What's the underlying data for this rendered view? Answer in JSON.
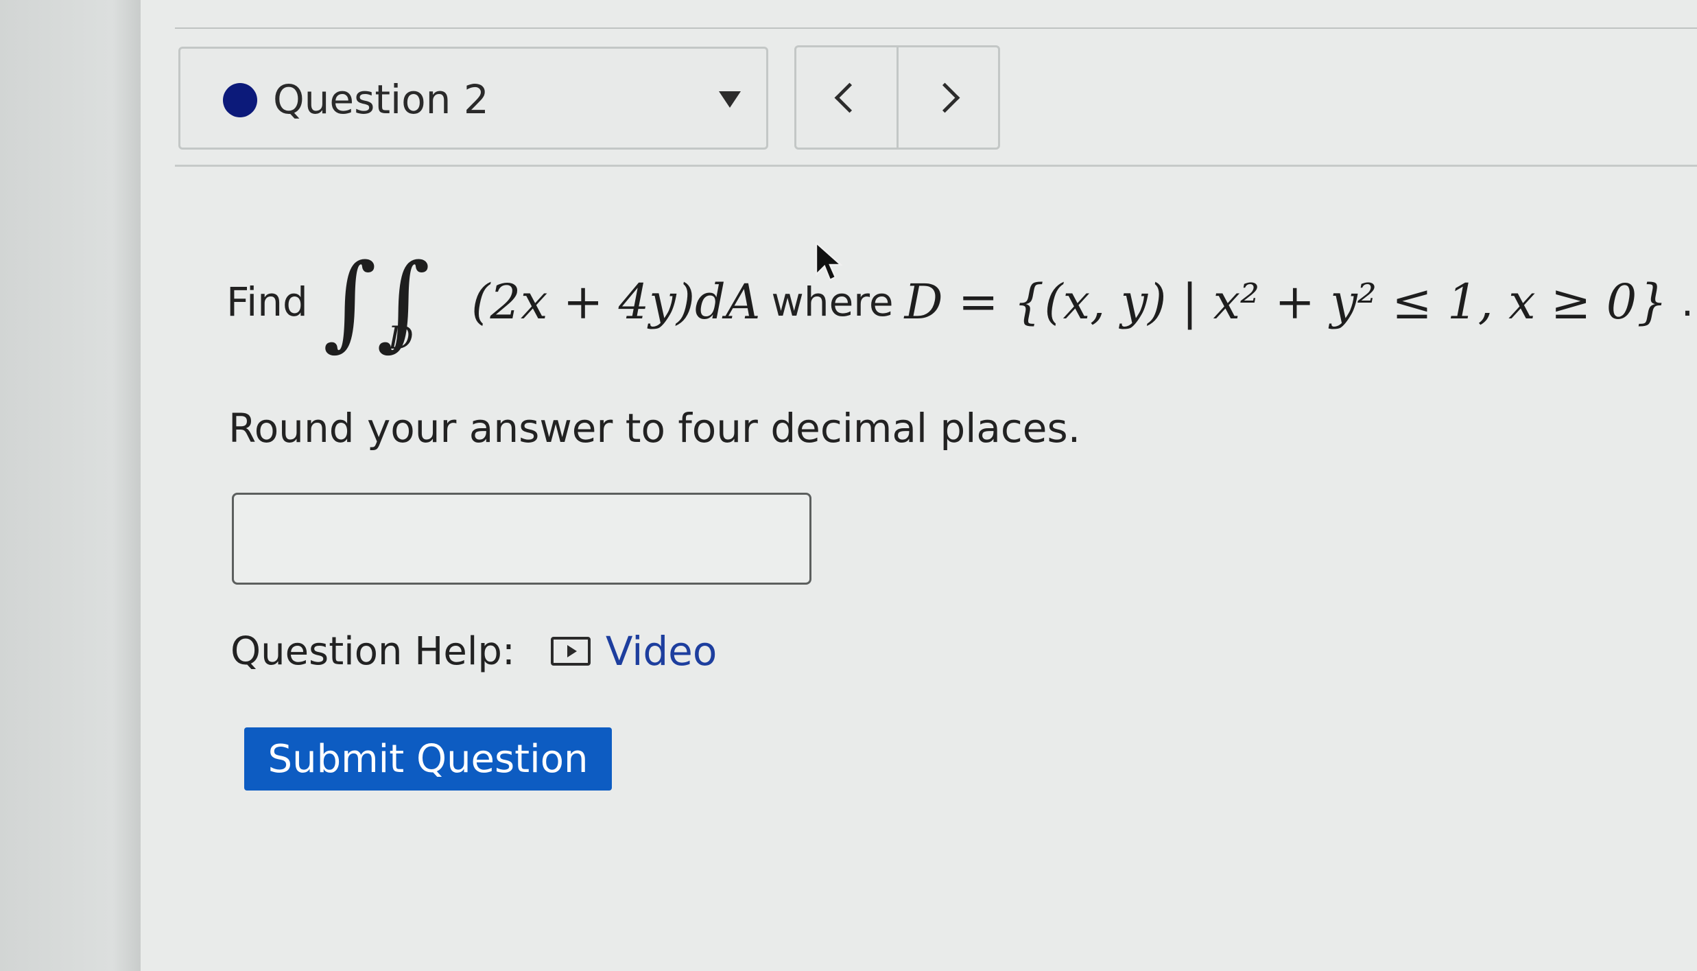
{
  "header": {
    "question_label": "Question 2",
    "status_color": "#0c1a7a",
    "dropdown_icon": "caret-down-icon",
    "prev_icon": "chevron-left-icon",
    "next_icon": "chevron-right-icon"
  },
  "problem": {
    "find_label": "Find",
    "integral_subscript": "D",
    "integrand": "(2x + 4y)dA",
    "where_label": "where",
    "region": "D = {(x, y) | x² + y² ≤ 1, x ≥ 0}",
    "end_punct": "."
  },
  "instructions": "Round your answer to four decimal places.",
  "answer": {
    "value": "",
    "placeholder": ""
  },
  "help": {
    "label": "Question Help:",
    "video_label": "Video",
    "video_icon": "play-video-icon"
  },
  "submit_label": "Submit Question",
  "colors": {
    "accent": "#0d5cc2",
    "link": "#1d3e9e"
  }
}
